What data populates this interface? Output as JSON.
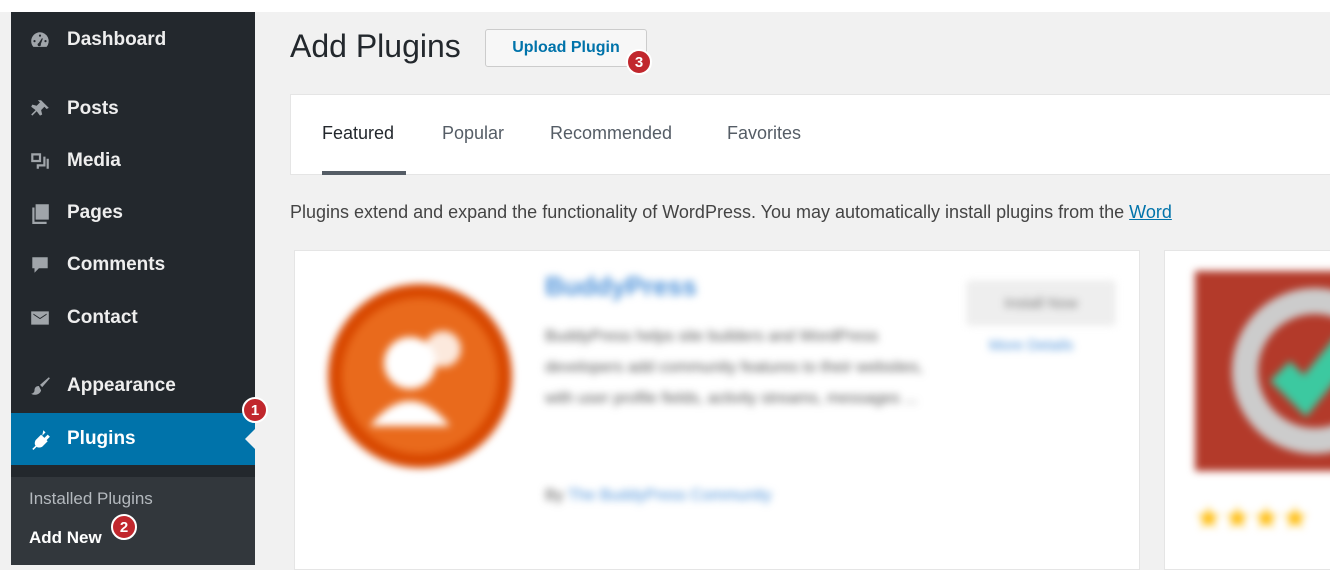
{
  "sidebar": {
    "items": [
      {
        "label": "Dashboard",
        "icon": "dashboard-icon"
      },
      {
        "label": "Posts",
        "icon": "pin-icon"
      },
      {
        "label": "Media",
        "icon": "media-icon"
      },
      {
        "label": "Pages",
        "icon": "pages-icon"
      },
      {
        "label": "Comments",
        "icon": "comment-icon"
      },
      {
        "label": "Contact",
        "icon": "envelope-icon"
      },
      {
        "label": "Appearance",
        "icon": "brush-icon"
      },
      {
        "label": "Plugins",
        "icon": "plug-icon",
        "active": true
      }
    ],
    "submenu": [
      {
        "label": "Installed Plugins"
      },
      {
        "label": "Add New",
        "current": true
      }
    ]
  },
  "header": {
    "title": "Add Plugins",
    "upload_label": "Upload Plugin"
  },
  "tabs": [
    {
      "label": "Featured",
      "current": true
    },
    {
      "label": "Popular"
    },
    {
      "label": "Recommended"
    },
    {
      "label": "Favorites"
    }
  ],
  "intro": {
    "text": "Plugins extend and expand the functionality of WordPress. You may automatically install plugins from the ",
    "link": "Word"
  },
  "badges": [
    "1",
    "2",
    "3"
  ],
  "cards": [
    {
      "title": "BuddyPress",
      "description": "BuddyPress helps site builders and WordPress developers add community features to their websites, with user profile fields, activity streams, messages ...",
      "author_prefix": "By ",
      "author": "The BuddyPress Community",
      "install_label": "Install Now",
      "details_label": "More Details"
    },
    {
      "rating": "★★★★"
    }
  ],
  "colors": {
    "sidebar_bg": "#23282d",
    "active_bg": "#0073aa",
    "badge": "#c1272d",
    "link": "#0073aa"
  }
}
